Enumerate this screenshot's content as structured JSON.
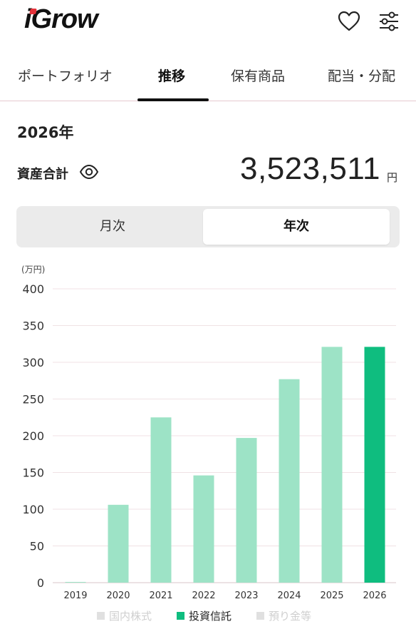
{
  "header": {
    "logo": "iGrow"
  },
  "icons": {
    "favorite": "heart-icon",
    "settings": "sliders-icon",
    "visibility": "eye-icon"
  },
  "tabs": [
    {
      "label": "ポートフォリオ"
    },
    {
      "label": "推移"
    },
    {
      "label": "保有商品"
    },
    {
      "label": "配当・分配"
    }
  ],
  "summary": {
    "year": "2026年",
    "asset_label": "資産合計",
    "asset_value": "3,523,511",
    "asset_unit": "円"
  },
  "period_toggle": {
    "monthly": "月次",
    "yearly": "年次",
    "selected": "年次"
  },
  "colors": {
    "accent": "#e5323a",
    "bar_light": "#9de3c6",
    "bar_active": "#0fbd7f",
    "legend_inactive": "#e0e0e0"
  },
  "chart_data": {
    "type": "bar",
    "unit_label": "(万円)",
    "categories": [
      "2019",
      "2020",
      "2021",
      "2022",
      "2023",
      "2024",
      "2025",
      "2026"
    ],
    "series": [
      {
        "name": "投資信託",
        "values": [
          1,
          106,
          225,
          146,
          197,
          277,
          321,
          321
        ]
      }
    ],
    "highlighted_category": "2026",
    "ylim": [
      0,
      400
    ],
    "yticks": [
      0,
      50,
      100,
      150,
      200,
      250,
      300,
      350,
      400
    ],
    "grid": true,
    "legend": [
      {
        "label": "国内株式",
        "active": false
      },
      {
        "label": "投資信託",
        "active": true
      },
      {
        "label": "預り金等",
        "active": false
      }
    ],
    "legend_position": "bottom"
  }
}
